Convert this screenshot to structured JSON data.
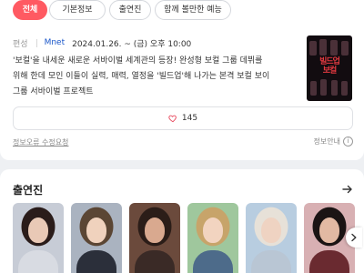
{
  "tabs": [
    {
      "label": "전체",
      "active": true
    },
    {
      "label": "기본정보",
      "active": false
    },
    {
      "label": "출연진",
      "active": false
    },
    {
      "label": "함께 볼만한 예능",
      "active": false
    }
  ],
  "broadcast": {
    "type": "편성",
    "channel": "Mnet",
    "datetime": "2024.01.26. ~  (금) 오후 10:00"
  },
  "description": "'보컬'을 내세운 새로운 서바이벌 세계관의 등장! 완성형 보컬 그룹 데뷔를\n위해 한데 모인 이들이 실력, 매력, 열정을 '빌드업'해 나가는 본격 보컬 보이\n그룹 서바이벌 프로젝트",
  "poster": {
    "title": "빌드업\n보컬"
  },
  "like": {
    "count": "145",
    "icon": "heart-icon",
    "color": "#e84a5f"
  },
  "links": {
    "report": "정보오류 수정요청",
    "info": "정보안내",
    "info_icon": "i"
  },
  "cast": {
    "title": "출연진",
    "members": [
      {
        "hair": "#2a1c1a",
        "skin": "#e9c9b6",
        "cloth": "#d8dbe2",
        "bg": "#c7ccd6"
      },
      {
        "hair": "#5b4634",
        "skin": "#f0d2bd",
        "cloth": "#2b2f3a",
        "bg": "#aab3c0"
      },
      {
        "hair": "#2b1d18",
        "skin": "#d9a98f",
        "cloth": "#3a2a26",
        "bg": "#6b4a3c"
      },
      {
        "hair": "#c7a46a",
        "skin": "#f2d4c0",
        "cloth": "#4d6b8a",
        "bg": "#9fc79d"
      },
      {
        "hair": "#e7e1d8",
        "skin": "#efd3c2",
        "cloth": "#b9c6d4",
        "bg": "#b8cde0"
      },
      {
        "hair": "#1b1414",
        "skin": "#e2b9a3",
        "cloth": "#6a2a30",
        "bg": "#d8b0b3"
      }
    ]
  }
}
